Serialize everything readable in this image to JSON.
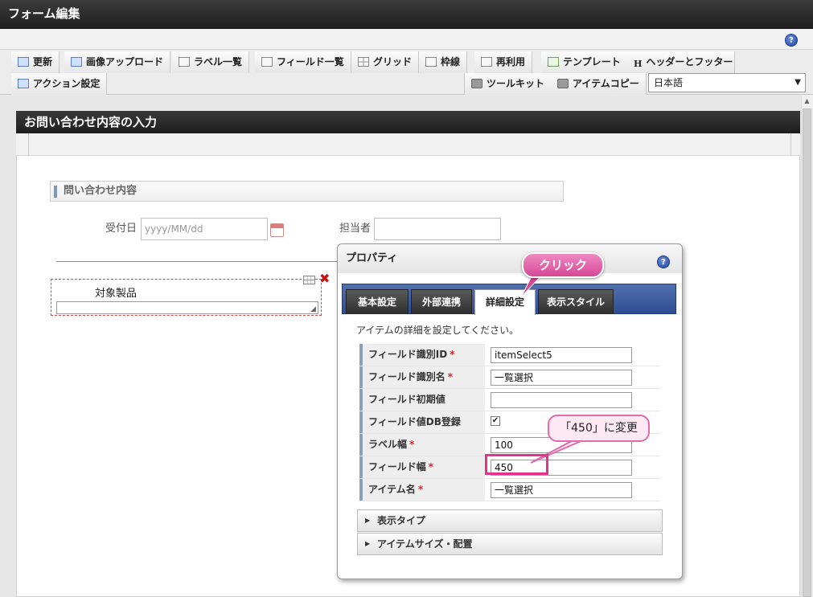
{
  "window": {
    "title": "フォーム編集"
  },
  "toolbar": {
    "row1": [
      {
        "label": "更新",
        "icon": "refresh-icon"
      },
      {
        "label": "画像アップロード",
        "icon": "image-upload-icon"
      },
      {
        "label": "ラベル一覧",
        "icon": "label-list-icon"
      },
      {
        "label": "フィールド一覧",
        "icon": "field-list-icon"
      },
      {
        "label": "グリッド",
        "icon": "grid-icon"
      },
      {
        "label": "枠線",
        "icon": "border-icon"
      },
      {
        "label": "再利用",
        "icon": "reuse-icon"
      },
      {
        "label": "テンプレート",
        "icon": "template-icon"
      },
      {
        "label": "ヘッダーとフッター",
        "icon": "header-footer-icon"
      }
    ],
    "row2_left": {
      "label": "アクション設定",
      "icon": "action-icon"
    },
    "row2_right": [
      {
        "label": "ツールキット",
        "icon": "toolkit-icon"
      },
      {
        "label": "アイテムコピー",
        "icon": "item-copy-icon"
      }
    ],
    "language": {
      "selected": "日本語"
    }
  },
  "form": {
    "title": "お問い合わせ内容の入力",
    "section_title": "問い合わせ内容",
    "received_date": {
      "label": "受付日",
      "placeholder": "yyyy/MM/dd"
    },
    "assignee": {
      "label": "担当者",
      "value": ""
    },
    "target_product": {
      "label": "対象製品"
    }
  },
  "property_dialog": {
    "title": "プロパティ",
    "tabs": [
      "基本設定",
      "外部連携",
      "詳細設定",
      "表示スタイル"
    ],
    "active_tab": "詳細設定",
    "description": "アイテムの詳細を設定してください。",
    "rows": [
      {
        "label": "フィールド識別ID",
        "required": "*",
        "value": "itemSelect5"
      },
      {
        "label": "フィールド識別名",
        "required": "*",
        "value": "一覧選択"
      },
      {
        "label": "フィールド初期値",
        "required": "",
        "value": ""
      },
      {
        "label": "フィールド値DB登録",
        "required": "",
        "checked": "✔"
      },
      {
        "label": "ラベル幅",
        "required": "*",
        "value": "100"
      },
      {
        "label": "フィールド幅",
        "required": "*",
        "value": "450"
      },
      {
        "label": "アイテム名",
        "required": "*",
        "value": "一覧選択"
      }
    ],
    "accordions": [
      "表示タイプ",
      "アイテムサイズ・配置"
    ]
  },
  "callouts": {
    "click": "クリック",
    "change": "「450」に変更"
  },
  "colors": {
    "title_bar": "#2a2a2a",
    "tab_bar": "#2d4e93",
    "callout_pink": "#d64796",
    "highlight": "#e2338e",
    "required": "#dd2222"
  }
}
